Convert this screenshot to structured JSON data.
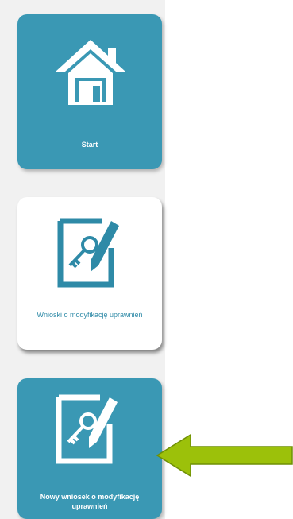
{
  "colors": {
    "sidebar_bg": "#f1f1f1",
    "tile_teal": "#3a98b4",
    "tile_white": "#ffffff",
    "text_teal": "#2e8aa7",
    "arrow_green": "#9cc10a"
  },
  "tiles": [
    {
      "icon": "house-icon",
      "label": "Start",
      "style": "teal"
    },
    {
      "icon": "signed-document-key-icon",
      "label": "Wnioski o modyfikację uprawnień",
      "style": "white"
    },
    {
      "icon": "signed-document-key-icon",
      "label": "Nowy wniosek o modyfikację uprawnień",
      "style": "teal"
    }
  ],
  "annotation": {
    "icon": "arrow-left-icon",
    "color": "green"
  }
}
